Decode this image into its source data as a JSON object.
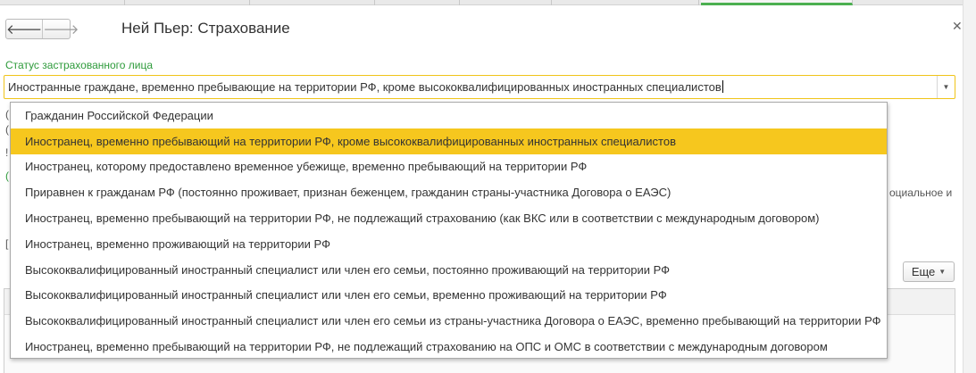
{
  "window": {
    "title": "Ней Пьер: Страхование",
    "nav_back": "🡐",
    "nav_forward": "🡒",
    "close": "✕"
  },
  "status_field": {
    "label": "Статус застрахованного лица",
    "value": "Иностранные граждане, временно пребывающие на территории РФ, кроме высококвалифицированных иностранных специалистов"
  },
  "options": [
    "Гражданин Российской Федерации",
    "Иностранец, временно пребывающий на территории РФ, кроме высококвалифицированных иностранных специалистов",
    "Иностранец, которому предоставлено временное убежище, временно пребывающий на территории РФ",
    "Приравнен к гражданам РФ (постоянно проживает, признан беженцем, гражданин страны-участника Договора о ЕАЭС)",
    "Иностранец, временно пребывающий на территории РФ, не подлежащий страхованию (как ВКС или в соответствии с международным договором)",
    "Иностранец, временно проживающий на территории РФ",
    "Высококвалифицированный иностранный специалист или член его семьи, постоянно проживающий на территории РФ",
    "Высококвалифицированный иностранный специалист или член его семьи, временно проживающий на территории РФ",
    "Высококвалифицированный иностранный специалист или член его семьи из страны-участника Договора о ЕАЭС, временно пребывающий на территории РФ",
    "Иностранец, временно пребывающий на территории РФ, не подлежащий страхованию на ОПС и ОМС в соответствии с международным договором"
  ],
  "selected_index": 1,
  "background": {
    "right_fragment": "оциальное и",
    "more_button": "Еще"
  },
  "colors": {
    "accent": "#f6c71e",
    "label_green": "#2e9b3b",
    "focus_border": "#f0c419"
  }
}
